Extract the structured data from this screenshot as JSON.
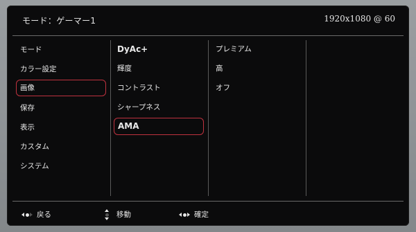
{
  "header": {
    "mode_title": "モード：ゲーマー1",
    "resolution": "1920x1080 @ 60"
  },
  "menu_main": [
    {
      "label": "モード"
    },
    {
      "label": "カラー設定"
    },
    {
      "label": "画像",
      "selected": true
    },
    {
      "label": "保存"
    },
    {
      "label": "表示"
    },
    {
      "label": "カスタム"
    },
    {
      "label": "システム"
    }
  ],
  "menu_sub": [
    {
      "label": "DyAc+"
    },
    {
      "label": "輝度"
    },
    {
      "label": "コントラスト"
    },
    {
      "label": "シャープネス"
    },
    {
      "label": "AMA",
      "selected": true
    }
  ],
  "menu_options": [
    {
      "label": "プレミアム"
    },
    {
      "label": "高"
    },
    {
      "label": "オフ"
    }
  ],
  "footer": {
    "back": "戻る",
    "move": "移動",
    "confirm": "確定"
  },
  "colors": {
    "selection_border": "#c0323f",
    "osd_background": "#0b0b0c",
    "text": "#e8e8e8"
  },
  "icons": {
    "back": "dpad-left-icon",
    "move": "dpad-up-down-icon",
    "confirm": "dpad-center-icon"
  }
}
